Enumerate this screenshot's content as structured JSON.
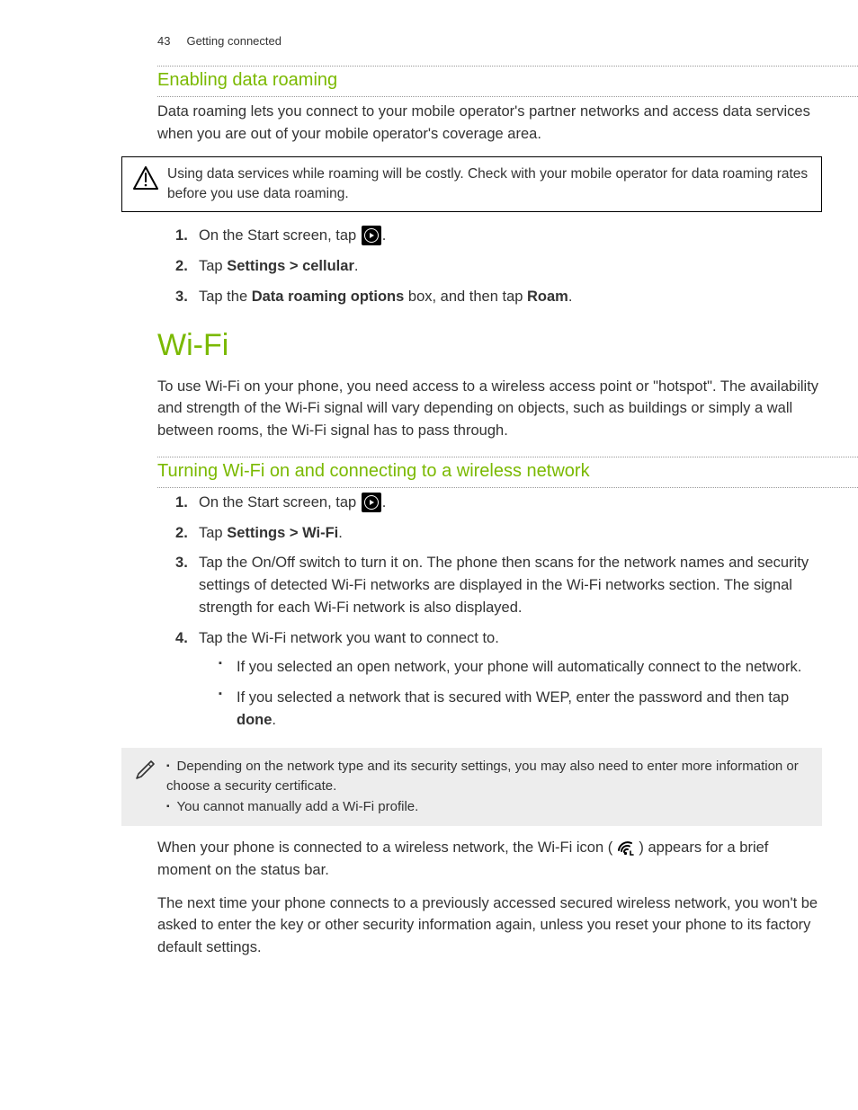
{
  "header": {
    "page_number": "43",
    "chapter": "Getting connected"
  },
  "section1": {
    "heading": "Enabling data roaming",
    "intro": "Data roaming lets you connect to your mobile operator's partner networks and access data services when you are out of your mobile operator's coverage area.",
    "warning": "Using data services while roaming will be costly. Check with your mobile operator for data roaming rates before you use data roaming.",
    "steps": {
      "s1_a": "On the Start screen, tap ",
      "s1_b": ".",
      "s2_a": "Tap ",
      "s2_b": "Settings > cellular",
      "s2_c": ".",
      "s3_a": "Tap the ",
      "s3_b": "Data roaming options",
      "s3_c": " box, and then tap ",
      "s3_d": "Roam",
      "s3_e": "."
    }
  },
  "section2": {
    "heading": "Wi-Fi",
    "intro": "To use Wi-Fi on your phone, you need access to a wireless access point or \"hotspot\". The availability and strength of the Wi-Fi signal will vary depending on objects, such as buildings or simply a wall between rooms, the Wi-Fi signal has to pass through."
  },
  "section3": {
    "heading": "Turning Wi-Fi on and connecting to a wireless network",
    "steps": {
      "s1_a": "On the Start screen, tap ",
      "s1_b": ".",
      "s2_a": "Tap ",
      "s2_b": "Settings > Wi-Fi",
      "s2_c": ".",
      "s3": "Tap the On/Off switch to turn it on. The phone then scans for the network names and security settings of detected Wi-Fi networks are displayed in the Wi-Fi networks section. The signal strength for each Wi-Fi network is also displayed.",
      "s4": "Tap the Wi-Fi network you want to connect to.",
      "s4_bullets": {
        "b1": "If you selected an open network, your phone will automatically connect to the network.",
        "b2_a": "If you selected a network that is secured with WEP, enter the password and then tap ",
        "b2_b": "done",
        "b2_c": "."
      }
    },
    "note": {
      "n1": "Depending on the network type and its security settings, you may also need to enter more information or choose a security certificate.",
      "n2": "You cannot manually add a Wi-Fi profile."
    },
    "closing1_a": "When your phone is connected to a wireless network, the Wi-Fi icon ( ",
    "closing1_b": " ) appears for a brief moment on the status bar.",
    "closing2": "The next time your phone connects to a previously accessed secured wireless network, you won't be asked to enter the key or other security information again, unless you reset your phone to its factory default settings."
  }
}
